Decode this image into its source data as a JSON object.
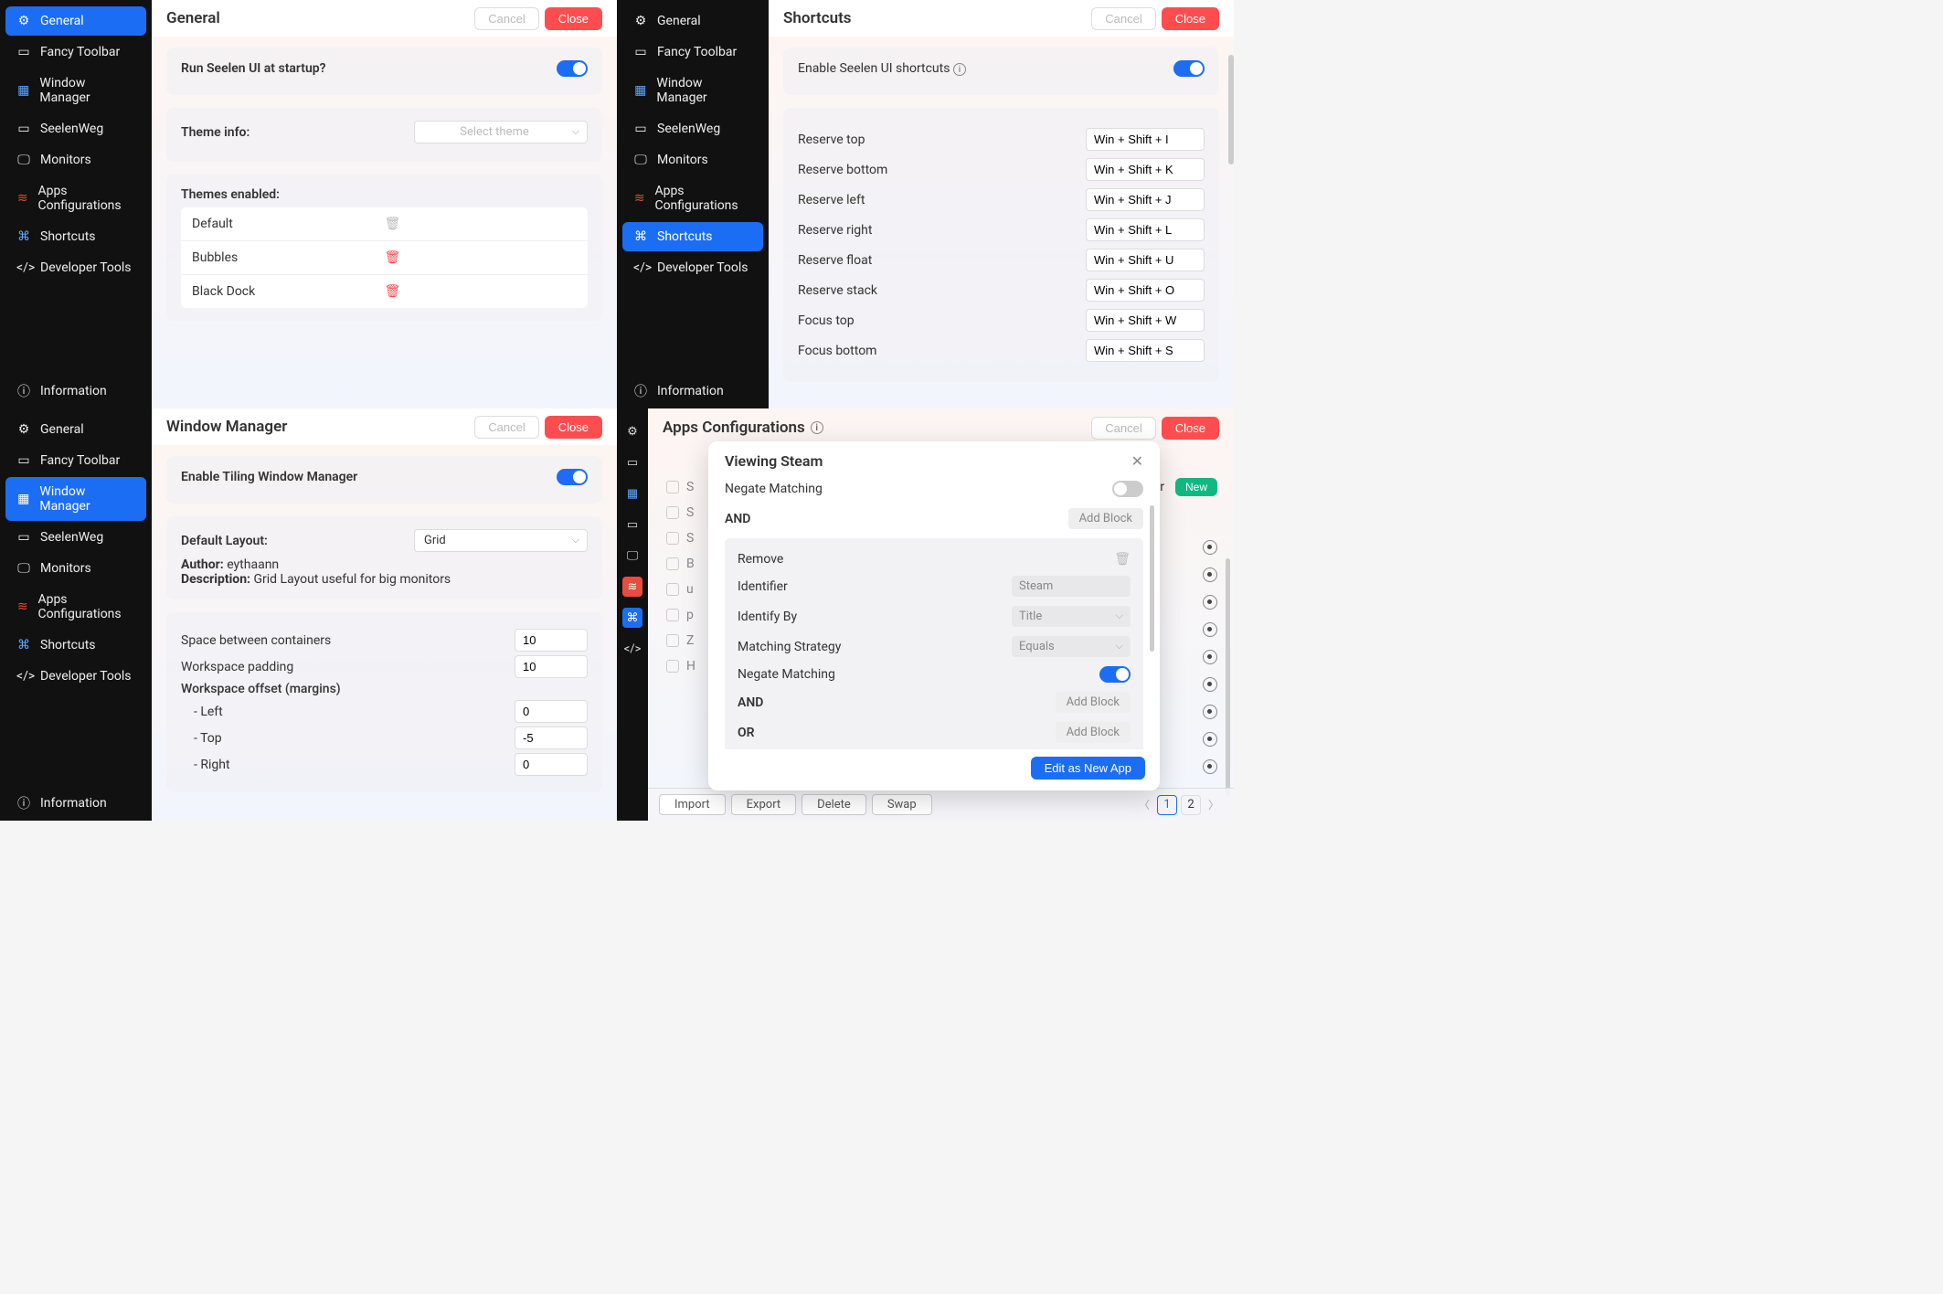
{
  "nav": {
    "general": "General",
    "fancy_toolbar": "Fancy Toolbar",
    "window_manager": "Window Manager",
    "seelenweg": "SeelenWeg",
    "monitors": "Monitors",
    "apps_config": "Apps Configurations",
    "shortcuts": "Shortcuts",
    "dev_tools": "Developer Tools",
    "information": "Information"
  },
  "buttons": {
    "cancel": "Cancel",
    "close": "Close",
    "new": "New",
    "edit_as_new": "Edit as New App",
    "add_block": "Add Block"
  },
  "general": {
    "title": "General",
    "run_startup": "Run Seelen UI at startup?",
    "theme_info": "Theme info:",
    "theme_placeholder": "Select theme",
    "themes_enabled": "Themes enabled:",
    "themes": [
      "Default",
      "Bubbles",
      "Black Dock"
    ]
  },
  "wm": {
    "title": "Window Manager",
    "enable_label": "Enable Tiling Window Manager",
    "default_layout_label": "Default Layout:",
    "default_layout_value": "Grid",
    "author_label": "Author:",
    "author_value": "eythaann",
    "desc_label": "Description:",
    "desc_value": "Grid Layout useful for big monitors",
    "space_label": "Space between containers",
    "space_value": "10",
    "padding_label": "Workspace padding",
    "padding_value": "10",
    "offset_label": "Workspace offset (margins)",
    "offset_left_label": "- Left",
    "offset_left_value": "0",
    "offset_top_label": "- Top",
    "offset_top_value": "-5",
    "offset_right_label": "- Right",
    "offset_right_value": "0"
  },
  "shortcuts": {
    "title": "Shortcuts",
    "enable_label": "Enable Seelen UI shortcuts",
    "rows": [
      {
        "label": "Reserve top",
        "keys": "Win + Shift + I"
      },
      {
        "label": "Reserve bottom",
        "keys": "Win + Shift + K"
      },
      {
        "label": "Reserve left",
        "keys": "Win + Shift + J"
      },
      {
        "label": "Reserve right",
        "keys": "Win + Shift + L"
      },
      {
        "label": "Reserve float",
        "keys": "Win + Shift + U"
      },
      {
        "label": "Reserve stack",
        "keys": "Win + Shift + O"
      },
      {
        "label": "Focus top",
        "keys": "Win + Shift + W"
      },
      {
        "label": "Focus bottom",
        "keys": "Win + Shift + S"
      }
    ]
  },
  "apps": {
    "title": "Apps Configurations",
    "search_for": "For",
    "bottom": {
      "import": "Import",
      "export": "Export",
      "delete": "Delete",
      "swap": "Swap"
    },
    "pages": [
      "1",
      "2"
    ],
    "bg_items": [
      "S",
      "S",
      "S",
      "B",
      "u",
      "p",
      "Z",
      "H"
    ]
  },
  "modal": {
    "title": "Viewing Steam",
    "negate1": "Negate Matching",
    "and1": "AND",
    "remove": "Remove",
    "identifier_label": "Identifier",
    "identifier_value": "Steam",
    "identify_by_label": "Identify By",
    "identify_by_value": "Title",
    "strategy_label": "Matching Strategy",
    "strategy_value": "Equals",
    "negate2": "Negate Matching",
    "and2": "AND",
    "or": "OR"
  }
}
